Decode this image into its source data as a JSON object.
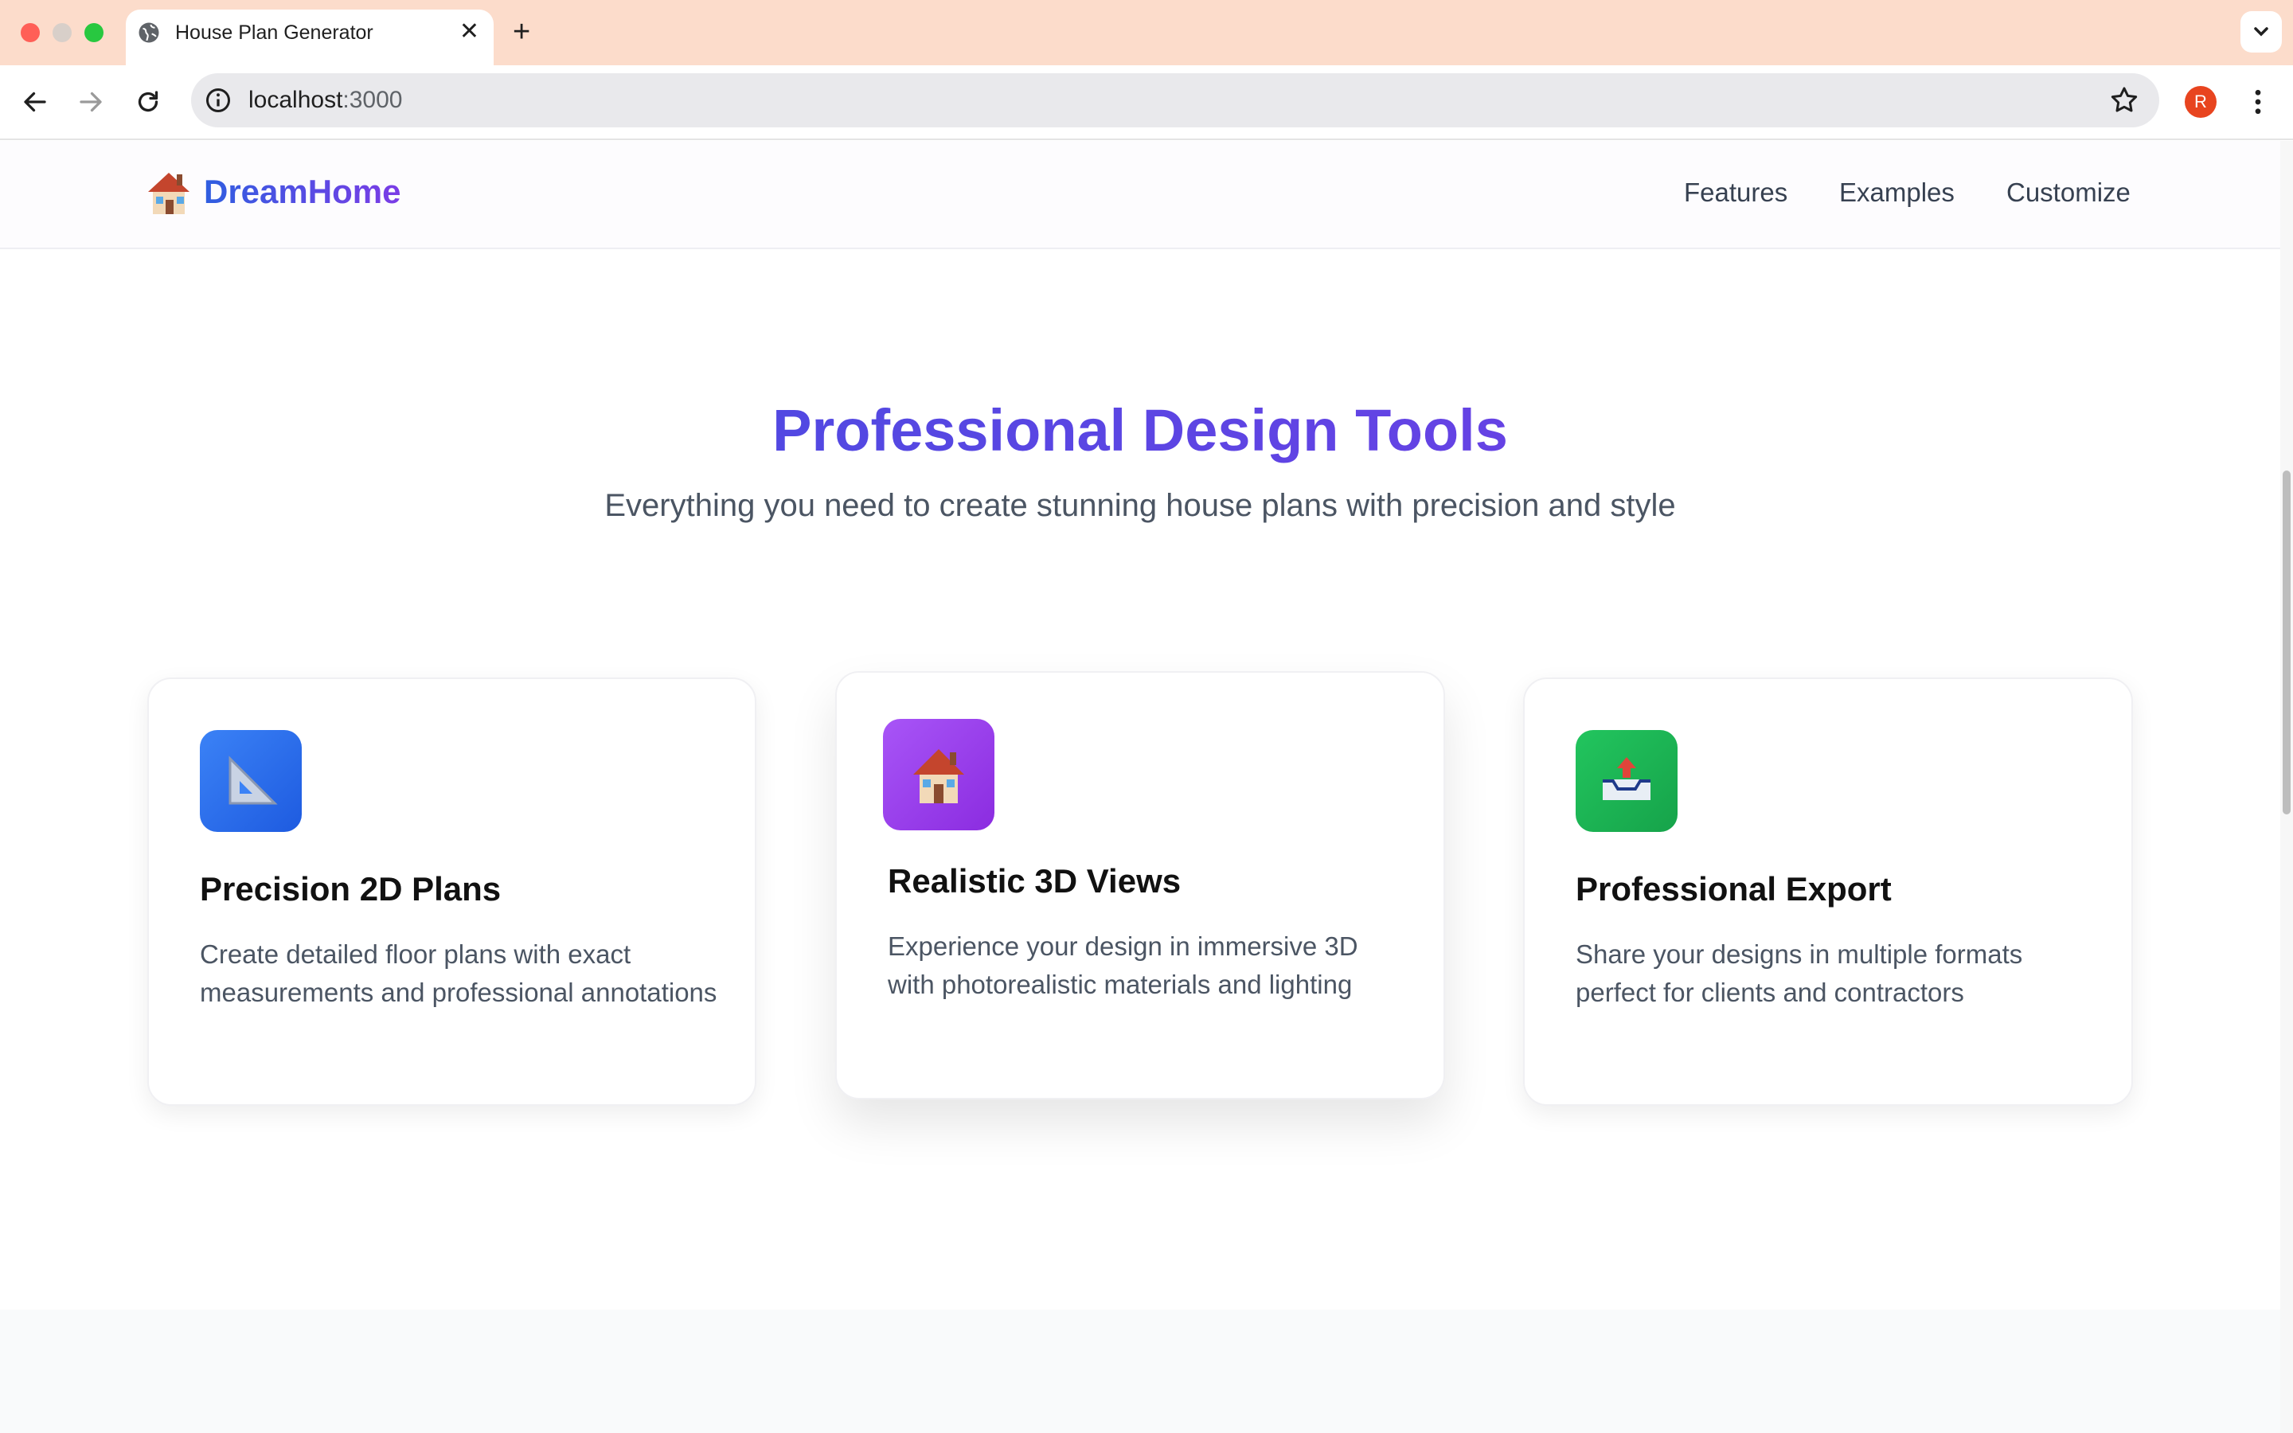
{
  "browser": {
    "tab_title": "House Plan Generator",
    "new_tab_label": "+",
    "url_host": "localhost",
    "url_port": ":3000",
    "profile_initial": "R"
  },
  "header": {
    "logo_text": "DreamHome",
    "nav": [
      "Features",
      "Examples",
      "Customize"
    ]
  },
  "hero": {
    "title": "Professional Design Tools",
    "subtitle": "Everything you need to create stunning house plans with precision and style"
  },
  "cards": [
    {
      "icon": "triangle-ruler-icon",
      "title": "Precision 2D Plans",
      "desc": "Create detailed floor plans with exact measurements and professional annotations",
      "color": "#2563eb"
    },
    {
      "icon": "house-icon",
      "title": "Realistic 3D Views",
      "desc": "Experience your design in immersive 3D with photorealistic materials and lighting",
      "color": "#9333ea"
    },
    {
      "icon": "outbox-tray-icon",
      "title": "Professional Export",
      "desc": "Share your designs in multiple formats perfect for clients and contractors",
      "color": "#16a34a"
    }
  ]
}
